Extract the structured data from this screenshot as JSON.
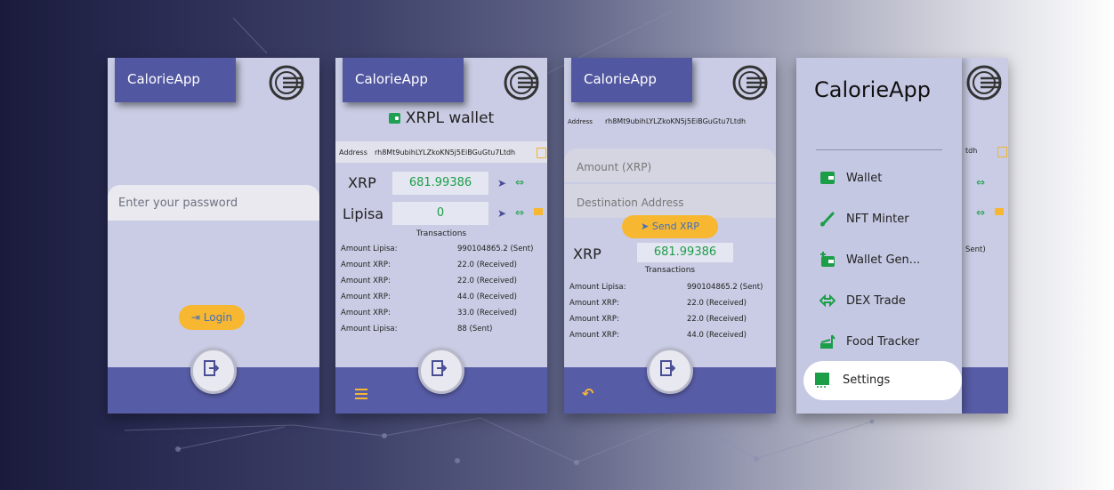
{
  "app_name": "CalorieApp",
  "colors": {
    "primary": "#5157a0",
    "accent": "#f7b731",
    "green": "#1c9e48",
    "panel": "#c9cce4"
  },
  "login_screen": {
    "password_placeholder": "Enter your password",
    "login_button": "Login"
  },
  "wallet_screen": {
    "title": "XRPL wallet",
    "address_label": "Address",
    "address": "rh8Mt9ubihLYLZkoKN5j5EiBGuGtu7Ltdh",
    "xrp_label": "XRP",
    "xrp_value": "681.99386",
    "lipisa_label": "Lipisa",
    "lipisa_value": "0",
    "transactions_title": "Transactions",
    "transactions": [
      {
        "label": "Amount Lipisa:",
        "value": "990104865.2 (Sent)"
      },
      {
        "label": "Amount XRP:",
        "value": "22.0 (Received)"
      },
      {
        "label": "Amount XRP:",
        "value": "22.0 (Received)"
      },
      {
        "label": "Amount XRP:",
        "value": "44.0 (Received)"
      },
      {
        "label": "Amount XRP:",
        "value": "33.0 (Received)"
      },
      {
        "label": "Amount Lipisa:",
        "value": "88 (Sent)"
      }
    ]
  },
  "send_screen": {
    "address_label": "Address",
    "address": "rh8Mt9ubihLYLZkoKN5j5EiBGuGtu7Ltdh",
    "amount_placeholder": "Amount (XRP)",
    "destination_placeholder": "Destination Address",
    "send_button": "Send XRP",
    "xrp_label": "XRP",
    "xrp_value": "681.99386",
    "transactions_title": "Transactions",
    "transactions": [
      {
        "label": "Amount Lipisa:",
        "value": "990104865.2 (Sent)"
      },
      {
        "label": "Amount XRP:",
        "value": "22.0 (Received)"
      },
      {
        "label": "Amount XRP:",
        "value": "22.0 (Received)"
      },
      {
        "label": "Amount XRP:",
        "value": "44.0 (Received)"
      }
    ]
  },
  "menu_screen": {
    "title": "CalorieApp",
    "items": [
      {
        "label": "Wallet",
        "icon": "wallet-icon"
      },
      {
        "label": "NFT Minter",
        "icon": "brush-icon"
      },
      {
        "label": "Wallet Gen...",
        "icon": "wallet-add-icon"
      },
      {
        "label": "DEX Trade",
        "icon": "swap-icon"
      },
      {
        "label": "Food Tracker",
        "icon": "food-icon"
      },
      {
        "label": "Settings",
        "icon": "settings-icon"
      }
    ],
    "peek_address": "tdh",
    "peek_tx": "Sent)"
  }
}
